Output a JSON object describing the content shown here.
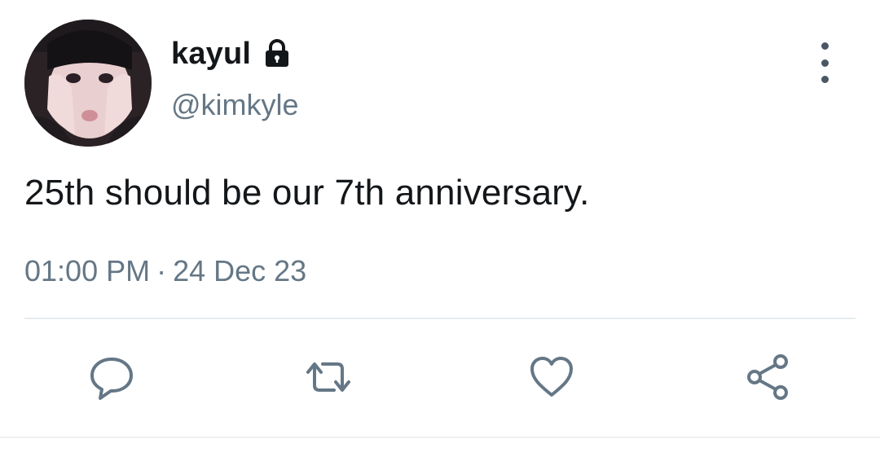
{
  "tweet": {
    "display_name": "kayul",
    "handle": "@kimkyle",
    "text": "25th should be our 7th anniversary.",
    "time": "01:00 PM",
    "separator": "·",
    "date": "24 Dec 23",
    "protected": true
  },
  "icons": {
    "lock": "lock-icon",
    "more": "more-vertical-icon",
    "reply": "reply-icon",
    "retweet": "retweet-icon",
    "like": "heart-icon",
    "share": "share-icon"
  },
  "colors": {
    "text": "#14171a",
    "secondary": "#657786",
    "icon": "#657786",
    "divider": "#e6ecf0"
  }
}
